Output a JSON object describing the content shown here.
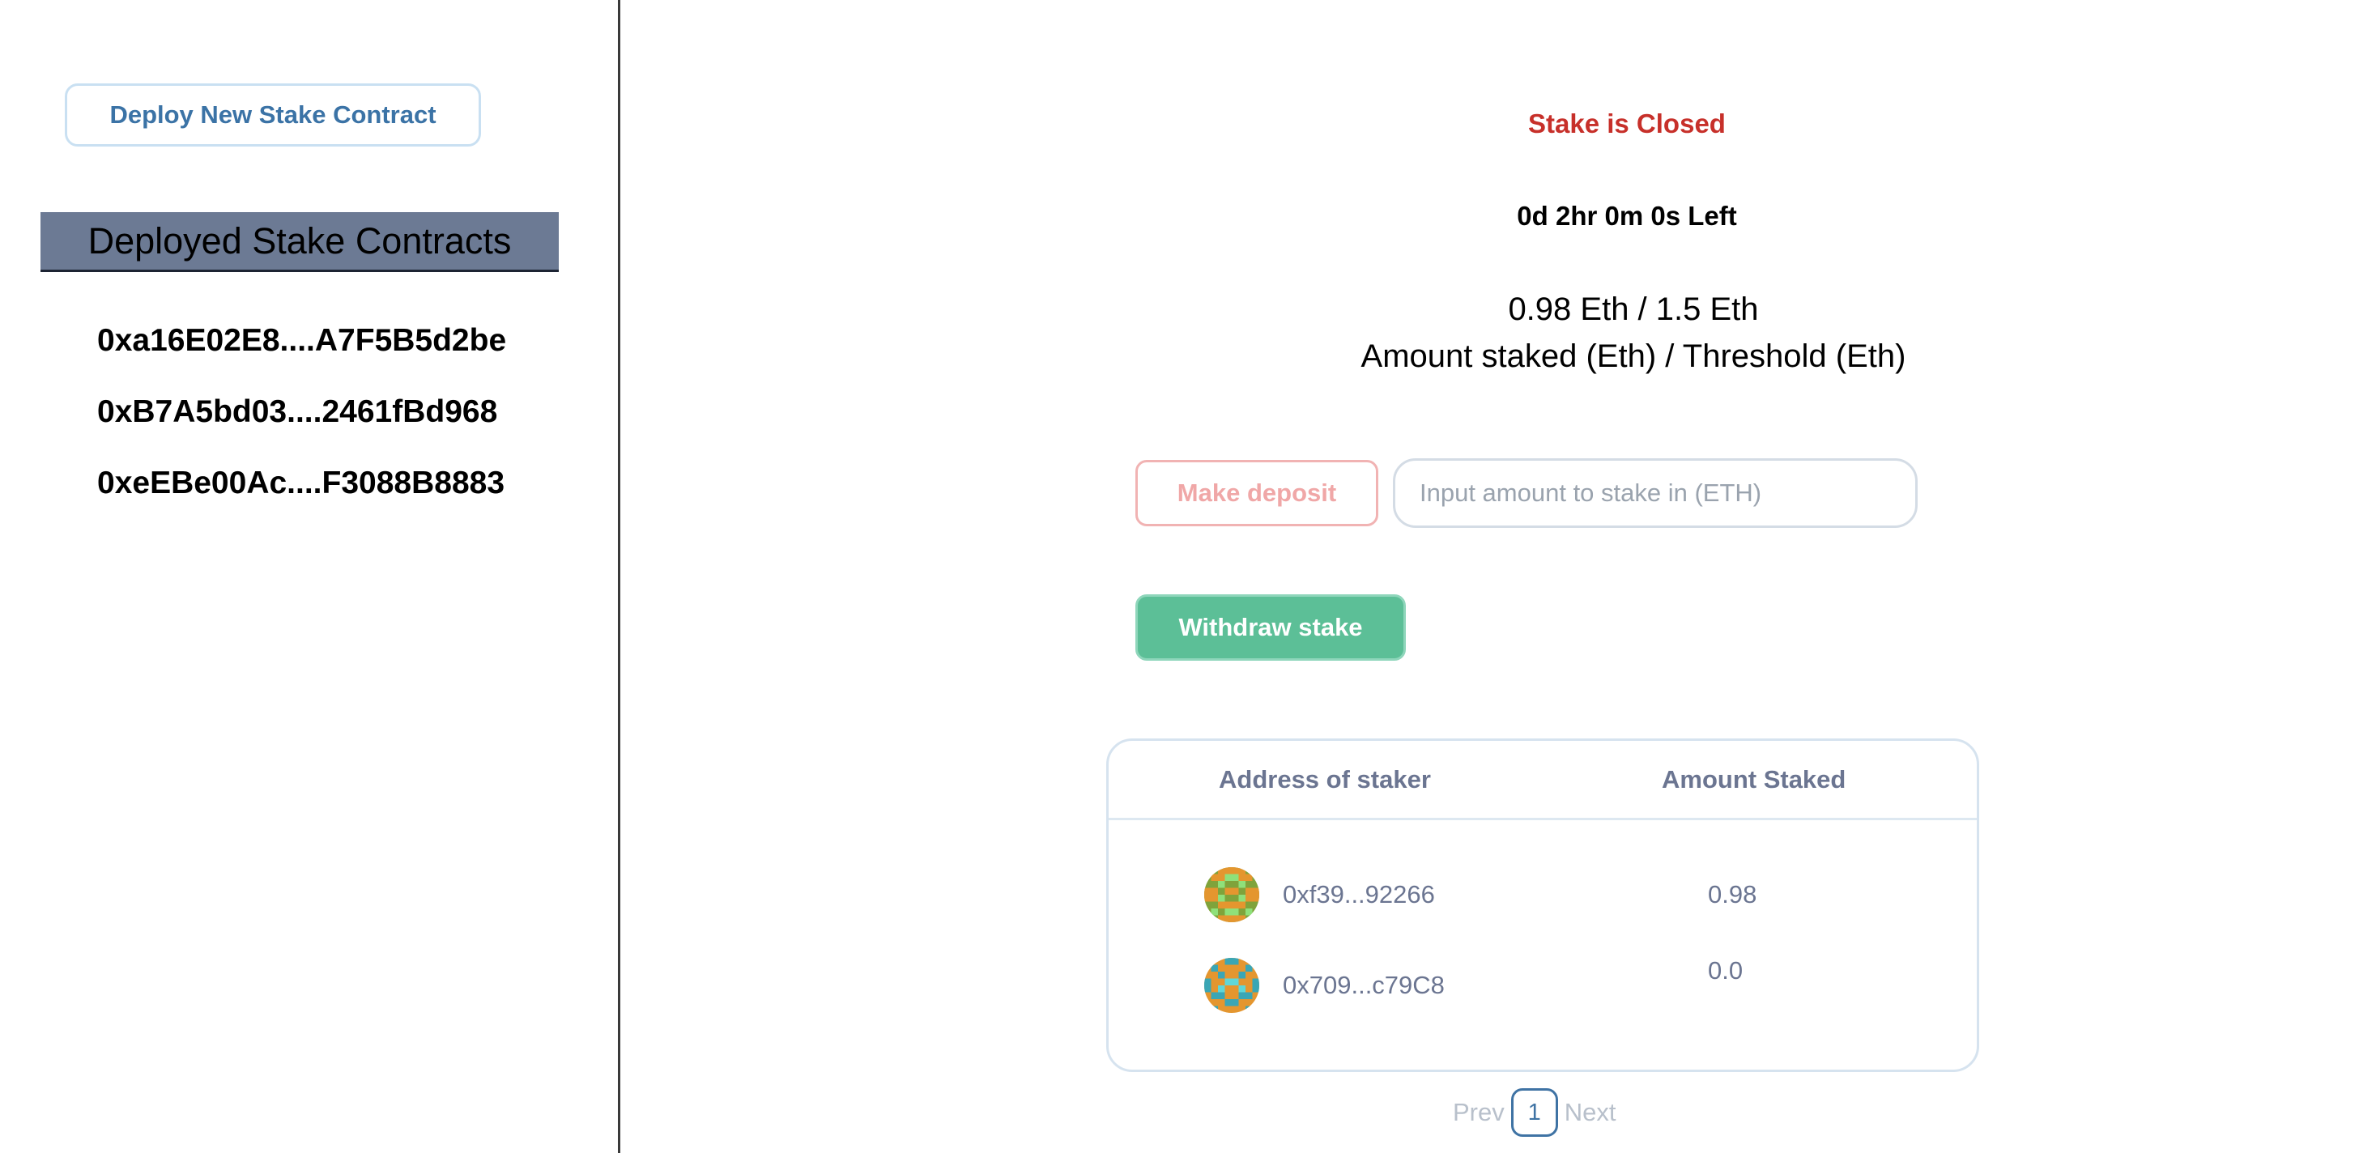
{
  "sidebar": {
    "deploy_button": "Deploy New Stake Contract",
    "header": "Deployed Stake Contracts",
    "contracts": [
      "0xa16E02E8....A7F5B5d2be",
      "0xB7A5bd03....2461fBd968",
      "0xeEBe00Ac....F3088B8883"
    ]
  },
  "main": {
    "status": "Stake is Closed",
    "countdown": "0d 2hr 0m 0s Left",
    "amount_line": "0.98 Eth / 1.5 Eth",
    "amount_caption": "Amount staked (Eth) / Threshold (Eth)",
    "deposit_button": "Make deposit",
    "stake_input_placeholder": "Input amount to stake in (ETH)",
    "withdraw_button": "Withdraw stake",
    "table": {
      "headers": [
        "Address of staker",
        "Amount Staked"
      ],
      "rows": [
        {
          "address": "0xf39...92266",
          "amount": "0.98"
        },
        {
          "address": "0x709...c79C8",
          "amount": "0.0"
        }
      ]
    },
    "pagination": {
      "prev": "Prev",
      "page": "1",
      "next": "Next"
    }
  },
  "colors": {
    "status_closed": "#c7302a",
    "deploy_text": "#3b73a6",
    "header_bg": "#6c7a94",
    "withdraw_bg": "#5cbf97",
    "deposit_disabled": "#f0a7a7"
  }
}
